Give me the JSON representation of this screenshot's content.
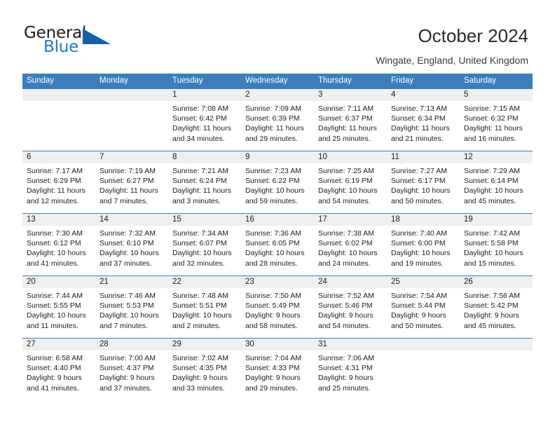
{
  "brand": {
    "word1": "General",
    "word2": "Blue",
    "accent_color": "#1362a8",
    "text_color": "#1b1b1b"
  },
  "header": {
    "title": "October 2024",
    "location": "Wingate, England, United Kingdom"
  },
  "calendar": {
    "header_bg": "#3a7ebf",
    "daynum_bg": "#efefef",
    "weekdays": [
      "Sunday",
      "Monday",
      "Tuesday",
      "Wednesday",
      "Thursday",
      "Friday",
      "Saturday"
    ],
    "weeks": [
      [
        {
          "day": "",
          "sunrise": "",
          "sunset": "",
          "daylight1": "",
          "daylight2": "",
          "empty": true
        },
        {
          "day": "",
          "sunrise": "",
          "sunset": "",
          "daylight1": "",
          "daylight2": "",
          "empty": true
        },
        {
          "day": "1",
          "sunrise": "Sunrise: 7:08 AM",
          "sunset": "Sunset: 6:42 PM",
          "daylight1": "Daylight: 11 hours",
          "daylight2": "and 34 minutes."
        },
        {
          "day": "2",
          "sunrise": "Sunrise: 7:09 AM",
          "sunset": "Sunset: 6:39 PM",
          "daylight1": "Daylight: 11 hours",
          "daylight2": "and 29 minutes."
        },
        {
          "day": "3",
          "sunrise": "Sunrise: 7:11 AM",
          "sunset": "Sunset: 6:37 PM",
          "daylight1": "Daylight: 11 hours",
          "daylight2": "and 25 minutes."
        },
        {
          "day": "4",
          "sunrise": "Sunrise: 7:13 AM",
          "sunset": "Sunset: 6:34 PM",
          "daylight1": "Daylight: 11 hours",
          "daylight2": "and 21 minutes."
        },
        {
          "day": "5",
          "sunrise": "Sunrise: 7:15 AM",
          "sunset": "Sunset: 6:32 PM",
          "daylight1": "Daylight: 11 hours",
          "daylight2": "and 16 minutes."
        }
      ],
      [
        {
          "day": "6",
          "sunrise": "Sunrise: 7:17 AM",
          "sunset": "Sunset: 6:29 PM",
          "daylight1": "Daylight: 11 hours",
          "daylight2": "and 12 minutes."
        },
        {
          "day": "7",
          "sunrise": "Sunrise: 7:19 AM",
          "sunset": "Sunset: 6:27 PM",
          "daylight1": "Daylight: 11 hours",
          "daylight2": "and 7 minutes."
        },
        {
          "day": "8",
          "sunrise": "Sunrise: 7:21 AM",
          "sunset": "Sunset: 6:24 PM",
          "daylight1": "Daylight: 11 hours",
          "daylight2": "and 3 minutes."
        },
        {
          "day": "9",
          "sunrise": "Sunrise: 7:23 AM",
          "sunset": "Sunset: 6:22 PM",
          "daylight1": "Daylight: 10 hours",
          "daylight2": "and 59 minutes."
        },
        {
          "day": "10",
          "sunrise": "Sunrise: 7:25 AM",
          "sunset": "Sunset: 6:19 PM",
          "daylight1": "Daylight: 10 hours",
          "daylight2": "and 54 minutes."
        },
        {
          "day": "11",
          "sunrise": "Sunrise: 7:27 AM",
          "sunset": "Sunset: 6:17 PM",
          "daylight1": "Daylight: 10 hours",
          "daylight2": "and 50 minutes."
        },
        {
          "day": "12",
          "sunrise": "Sunrise: 7:29 AM",
          "sunset": "Sunset: 6:14 PM",
          "daylight1": "Daylight: 10 hours",
          "daylight2": "and 45 minutes."
        }
      ],
      [
        {
          "day": "13",
          "sunrise": "Sunrise: 7:30 AM",
          "sunset": "Sunset: 6:12 PM",
          "daylight1": "Daylight: 10 hours",
          "daylight2": "and 41 minutes."
        },
        {
          "day": "14",
          "sunrise": "Sunrise: 7:32 AM",
          "sunset": "Sunset: 6:10 PM",
          "daylight1": "Daylight: 10 hours",
          "daylight2": "and 37 minutes."
        },
        {
          "day": "15",
          "sunrise": "Sunrise: 7:34 AM",
          "sunset": "Sunset: 6:07 PM",
          "daylight1": "Daylight: 10 hours",
          "daylight2": "and 32 minutes."
        },
        {
          "day": "16",
          "sunrise": "Sunrise: 7:36 AM",
          "sunset": "Sunset: 6:05 PM",
          "daylight1": "Daylight: 10 hours",
          "daylight2": "and 28 minutes."
        },
        {
          "day": "17",
          "sunrise": "Sunrise: 7:38 AM",
          "sunset": "Sunset: 6:02 PM",
          "daylight1": "Daylight: 10 hours",
          "daylight2": "and 24 minutes."
        },
        {
          "day": "18",
          "sunrise": "Sunrise: 7:40 AM",
          "sunset": "Sunset: 6:00 PM",
          "daylight1": "Daylight: 10 hours",
          "daylight2": "and 19 minutes."
        },
        {
          "day": "19",
          "sunrise": "Sunrise: 7:42 AM",
          "sunset": "Sunset: 5:58 PM",
          "daylight1": "Daylight: 10 hours",
          "daylight2": "and 15 minutes."
        }
      ],
      [
        {
          "day": "20",
          "sunrise": "Sunrise: 7:44 AM",
          "sunset": "Sunset: 5:55 PM",
          "daylight1": "Daylight: 10 hours",
          "daylight2": "and 11 minutes."
        },
        {
          "day": "21",
          "sunrise": "Sunrise: 7:46 AM",
          "sunset": "Sunset: 5:53 PM",
          "daylight1": "Daylight: 10 hours",
          "daylight2": "and 7 minutes."
        },
        {
          "day": "22",
          "sunrise": "Sunrise: 7:48 AM",
          "sunset": "Sunset: 5:51 PM",
          "daylight1": "Daylight: 10 hours",
          "daylight2": "and 2 minutes."
        },
        {
          "day": "23",
          "sunrise": "Sunrise: 7:50 AM",
          "sunset": "Sunset: 5:49 PM",
          "daylight1": "Daylight: 9 hours",
          "daylight2": "and 58 minutes."
        },
        {
          "day": "24",
          "sunrise": "Sunrise: 7:52 AM",
          "sunset": "Sunset: 5:46 PM",
          "daylight1": "Daylight: 9 hours",
          "daylight2": "and 54 minutes."
        },
        {
          "day": "25",
          "sunrise": "Sunrise: 7:54 AM",
          "sunset": "Sunset: 5:44 PM",
          "daylight1": "Daylight: 9 hours",
          "daylight2": "and 50 minutes."
        },
        {
          "day": "26",
          "sunrise": "Sunrise: 7:56 AM",
          "sunset": "Sunset: 5:42 PM",
          "daylight1": "Daylight: 9 hours",
          "daylight2": "and 45 minutes."
        }
      ],
      [
        {
          "day": "27",
          "sunrise": "Sunrise: 6:58 AM",
          "sunset": "Sunset: 4:40 PM",
          "daylight1": "Daylight: 9 hours",
          "daylight2": "and 41 minutes."
        },
        {
          "day": "28",
          "sunrise": "Sunrise: 7:00 AM",
          "sunset": "Sunset: 4:37 PM",
          "daylight1": "Daylight: 9 hours",
          "daylight2": "and 37 minutes."
        },
        {
          "day": "29",
          "sunrise": "Sunrise: 7:02 AM",
          "sunset": "Sunset: 4:35 PM",
          "daylight1": "Daylight: 9 hours",
          "daylight2": "and 33 minutes."
        },
        {
          "day": "30",
          "sunrise": "Sunrise: 7:04 AM",
          "sunset": "Sunset: 4:33 PM",
          "daylight1": "Daylight: 9 hours",
          "daylight2": "and 29 minutes."
        },
        {
          "day": "31",
          "sunrise": "Sunrise: 7:06 AM",
          "sunset": "Sunset: 4:31 PM",
          "daylight1": "Daylight: 9 hours",
          "daylight2": "and 25 minutes."
        },
        {
          "day": "",
          "sunrise": "",
          "sunset": "",
          "daylight1": "",
          "daylight2": "",
          "empty": true
        },
        {
          "day": "",
          "sunrise": "",
          "sunset": "",
          "daylight1": "",
          "daylight2": "",
          "empty": true
        }
      ]
    ]
  }
}
